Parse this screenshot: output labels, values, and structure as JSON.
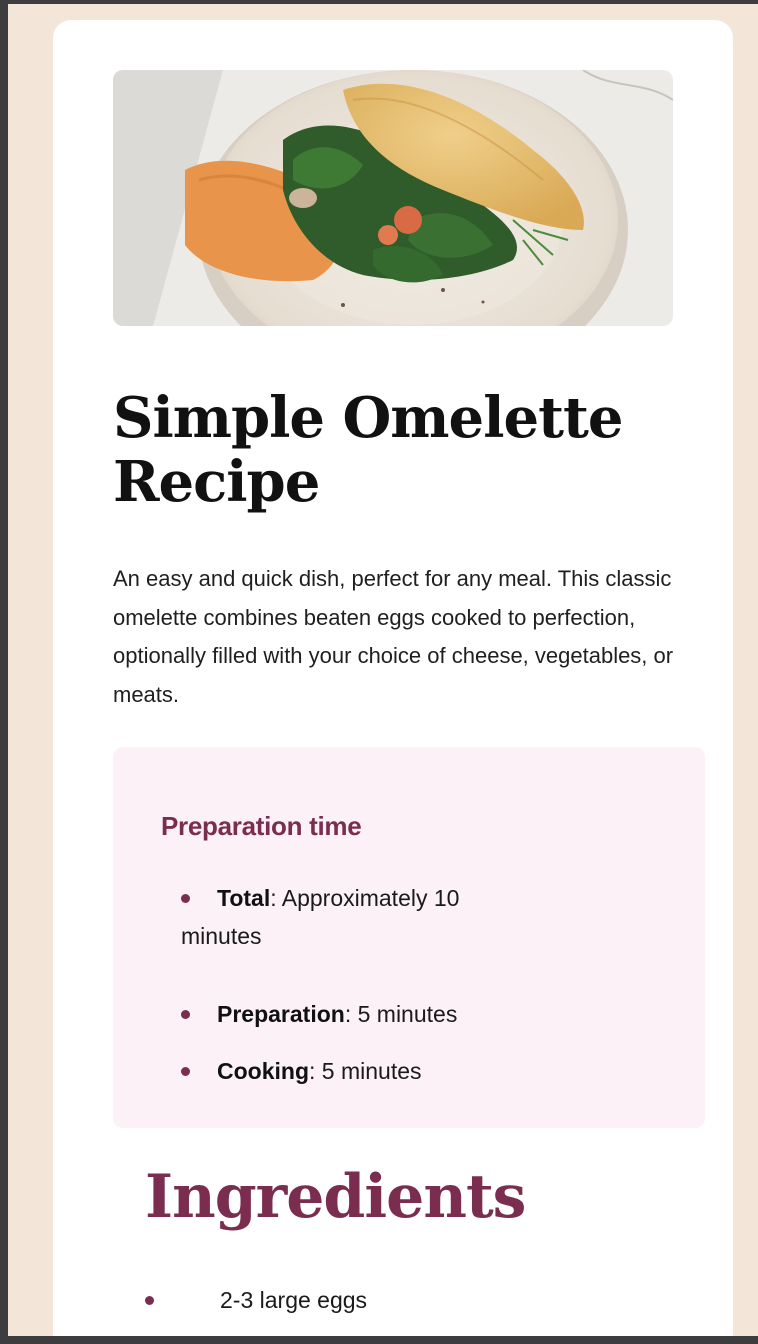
{
  "recipe": {
    "hero_image": "omelette-plate-image",
    "title": "Simple Omelette Recipe",
    "description": "An easy and quick dish, perfect for any meal. This classic omelette combines beaten eggs cooked to perfection, optionally filled with your choice of cheese, vegetables, or meats."
  },
  "preparation": {
    "heading": "Preparation time",
    "items": [
      {
        "label": "Total",
        "value": ": Approximately 10 minutes"
      },
      {
        "label": "Preparation",
        "value": ": 5 minutes"
      },
      {
        "label": "Cooking",
        "value": ": 5 minutes"
      }
    ]
  },
  "ingredients": {
    "heading": "Ingredients",
    "items": [
      "2-3 large eggs"
    ]
  },
  "colors": {
    "page_background": "#f3e5d8",
    "card_background": "#ffffff",
    "accent": "#7a2d4f",
    "prep_background": "#fbf1f6"
  }
}
